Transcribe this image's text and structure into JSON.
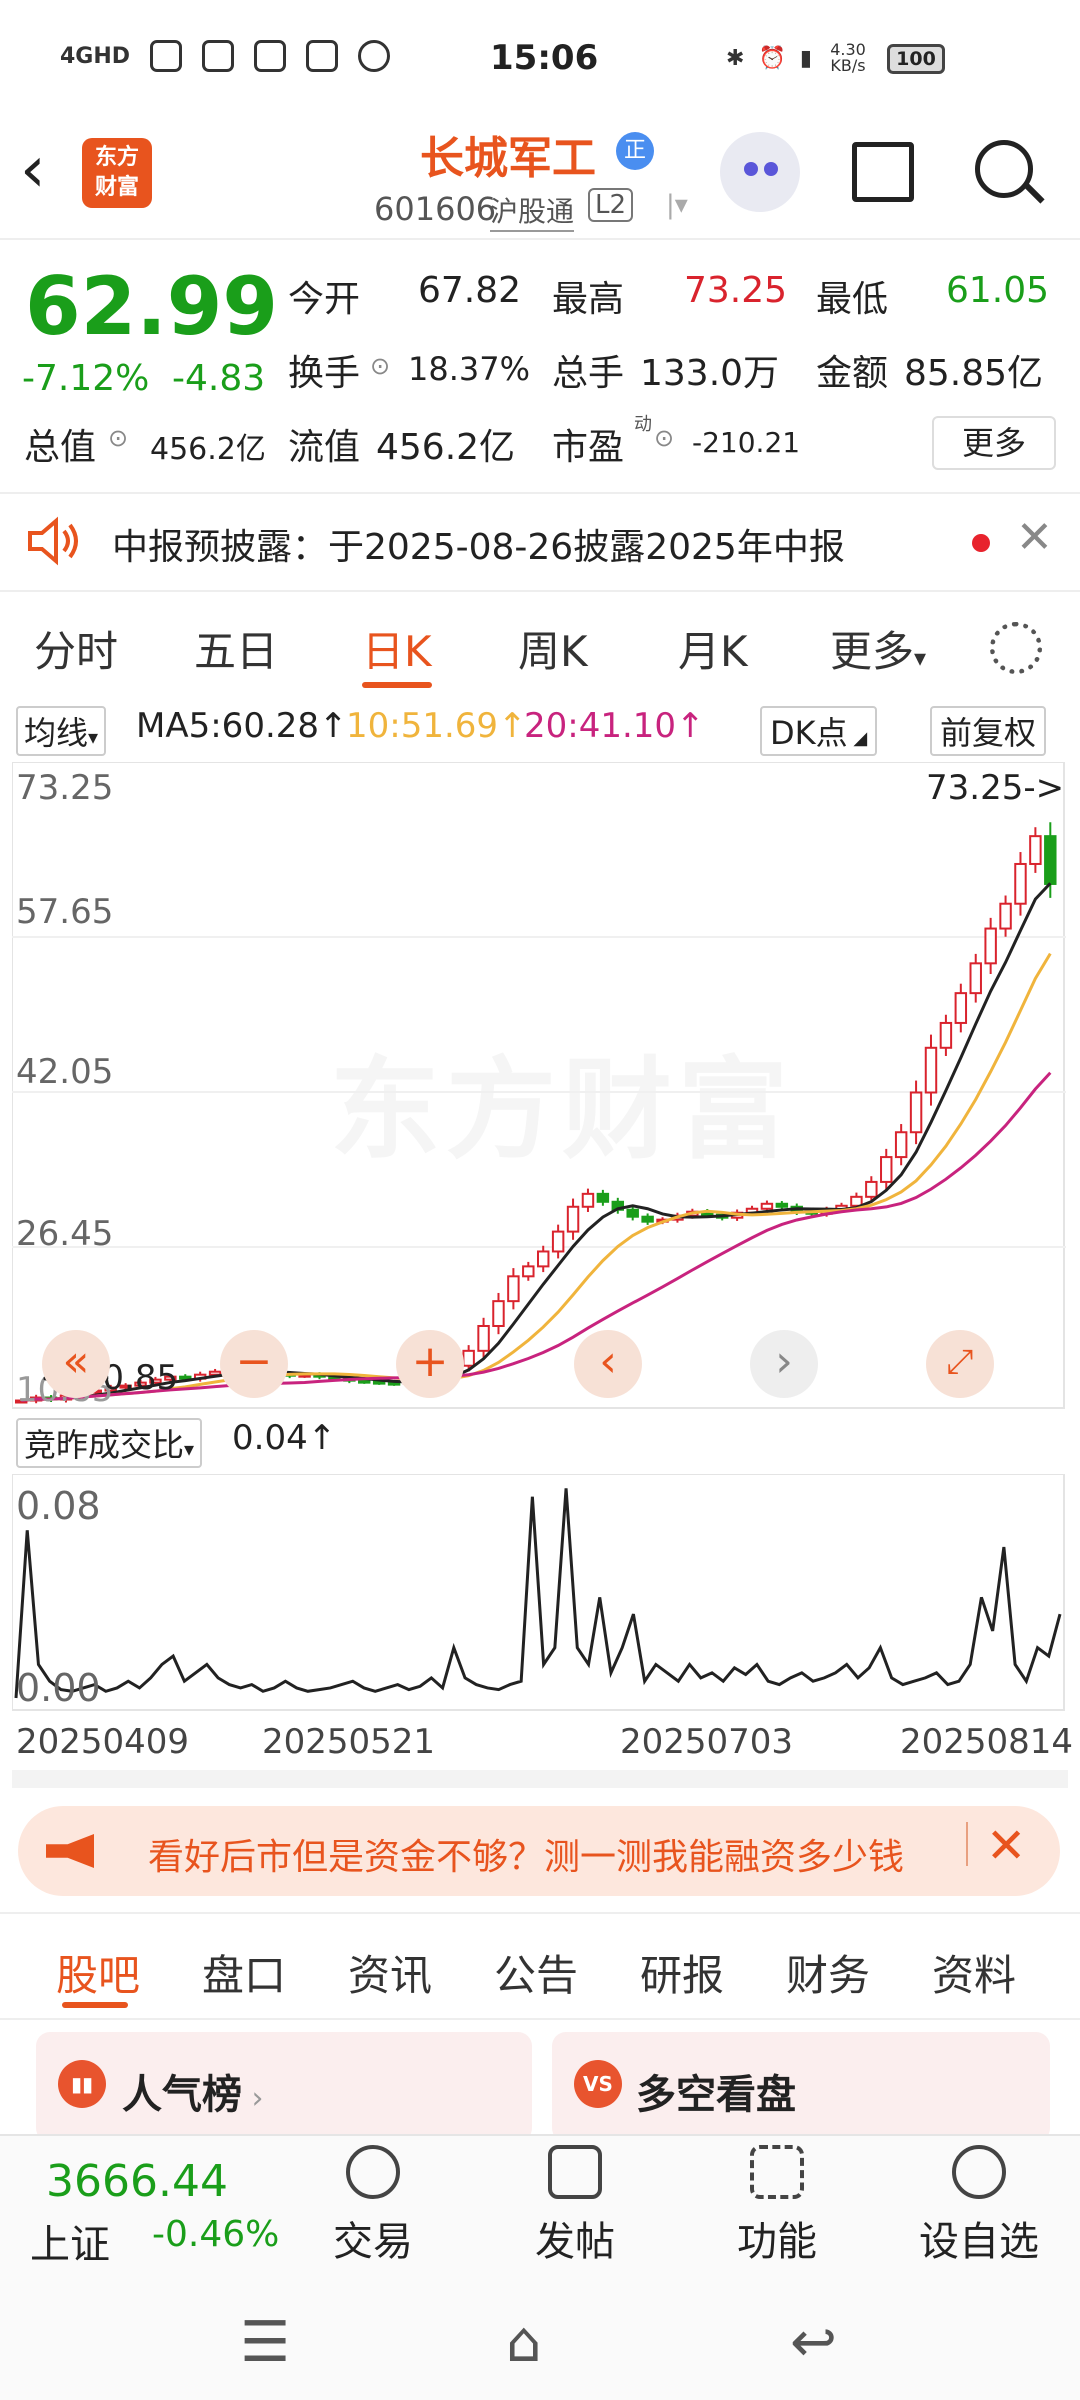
{
  "status_bar": {
    "network": "4GHD",
    "time": "15:06",
    "speed": "4.30 KB/s",
    "battery": "100"
  },
  "header": {
    "back_icon": "chevron-left-icon",
    "logo_top": "东方",
    "logo_bottom": "财富",
    "title": "长城军工",
    "title_badge": "正",
    "code": "601606",
    "market_tag": "沪股通",
    "level_tag": "L2"
  },
  "quote": {
    "price": "62.99",
    "change_pct": "-7.12%",
    "change_abs": "-4.83",
    "rows": [
      [
        {
          "label": "今开",
          "value": "67.82",
          "color": "#222"
        },
        {
          "label": "最高",
          "value": "73.25",
          "color": "#d9232d"
        },
        {
          "label": "最低",
          "value": "61.05",
          "color": "#1a9e1a"
        }
      ],
      [
        {
          "label": "换手",
          "value": "18.37%",
          "color": "#222"
        },
        {
          "label": "总手",
          "value": "133.0万",
          "color": "#222"
        },
        {
          "label": "金额",
          "value": "85.85亿",
          "color": "#222"
        }
      ]
    ],
    "total_cap_label": "总值",
    "total_cap": "456.2亿",
    "float_cap_label": "流值",
    "float_cap": "456.2亿",
    "pe_label": "市盈",
    "pe_sup": "动",
    "pe": "-210.21",
    "more_label": "更多"
  },
  "notice": {
    "text": "中报预披露：于2025-08-26披露2025年中报"
  },
  "chart_tabs": [
    "分时",
    "五日",
    "日K",
    "周K",
    "月K",
    "更多"
  ],
  "active_tab": "日K",
  "indicators": {
    "ma_label": "均线",
    "ma5": "MA5:60.28",
    "ma10": "10:51.69",
    "ma20": "20:41.10",
    "dk_label": "DK点",
    "adjust_label": "前复权"
  },
  "chart_data": {
    "type": "candlestick",
    "y_ticks": [
      "73.25",
      "57.65",
      "42.05",
      "26.45",
      "10.85"
    ],
    "ylim": [
      10.85,
      73.25
    ],
    "high_marker": "73.25->",
    "low_marker": "10.85",
    "watermark": "东方财富",
    "x_ticks": [
      "20250409",
      "20250521",
      "20250703",
      "20250814"
    ],
    "closes": [
      11.0,
      11.3,
      11.1,
      11.5,
      11.8,
      12.0,
      12.3,
      12.5,
      12.8,
      13.1,
      13.4,
      13.2,
      13.6,
      13.9,
      14.1,
      13.8,
      14.0,
      13.7,
      13.5,
      13.6,
      13.4,
      13.2,
      13.0,
      12.9,
      12.8,
      12.7,
      12.9,
      13.2,
      13.8,
      14.5,
      16.0,
      18.5,
      21.0,
      23.5,
      24.5,
      26.0,
      28.0,
      30.5,
      31.8,
      31.0,
      30.2,
      29.5,
      29.0,
      29.2,
      29.6,
      30.0,
      29.7,
      29.4,
      29.9,
      30.3,
      30.8,
      30.5,
      30.0,
      29.8,
      30.2,
      30.6,
      31.5,
      33.0,
      35.5,
      38.0,
      42.0,
      46.5,
      49.0,
      52.0,
      55.0,
      58.5,
      61.0,
      65.0,
      67.8,
      62.99
    ]
  },
  "vol_indicator": {
    "label": "竞昨成交比",
    "value": "0.04",
    "y_top": "0.08",
    "y_bottom": "0.00",
    "values": [
      0.0,
      0.1,
      0.02,
      0.01,
      0.005,
      0.004,
      0.006,
      0.008,
      0.004,
      0.006,
      0.01,
      0.006,
      0.012,
      0.02,
      0.025,
      0.01,
      0.015,
      0.02,
      0.012,
      0.008,
      0.006,
      0.008,
      0.004,
      0.006,
      0.01,
      0.006,
      0.004,
      0.005,
      0.006,
      0.008,
      0.01,
      0.006,
      0.004,
      0.006,
      0.008,
      0.005,
      0.007,
      0.012,
      0.006,
      0.03,
      0.012,
      0.008,
      0.006,
      0.005,
      0.008,
      0.01,
      0.12,
      0.02,
      0.03,
      0.125,
      0.03,
      0.02,
      0.06,
      0.015,
      0.03,
      0.05,
      0.01,
      0.02,
      0.015,
      0.01,
      0.02,
      0.012,
      0.015,
      0.01,
      0.018,
      0.014,
      0.02,
      0.01,
      0.008,
      0.012,
      0.015,
      0.01,
      0.012,
      0.015,
      0.02,
      0.012,
      0.018,
      0.03,
      0.012,
      0.008,
      0.01,
      0.012,
      0.015,
      0.008,
      0.01,
      0.02,
      0.06,
      0.04,
      0.09,
      0.02,
      0.01,
      0.03,
      0.025,
      0.05
    ]
  },
  "banner": {
    "text": "看好后市但是资金不够？测一测我能融资多少钱"
  },
  "bottom_tabs": [
    "股吧",
    "盘口",
    "资讯",
    "公告",
    "研报",
    "财务",
    "资料"
  ],
  "active_bottom_tab": "股吧",
  "cards": [
    {
      "icon": "rank",
      "title": "人气榜"
    },
    {
      "icon": "VS",
      "title": "多空看盘"
    }
  ],
  "index": {
    "value": "3666.44",
    "name": "上证",
    "change": "-0.46%"
  },
  "footer_items": [
    "交易",
    "发帖",
    "功能",
    "设自选"
  ]
}
